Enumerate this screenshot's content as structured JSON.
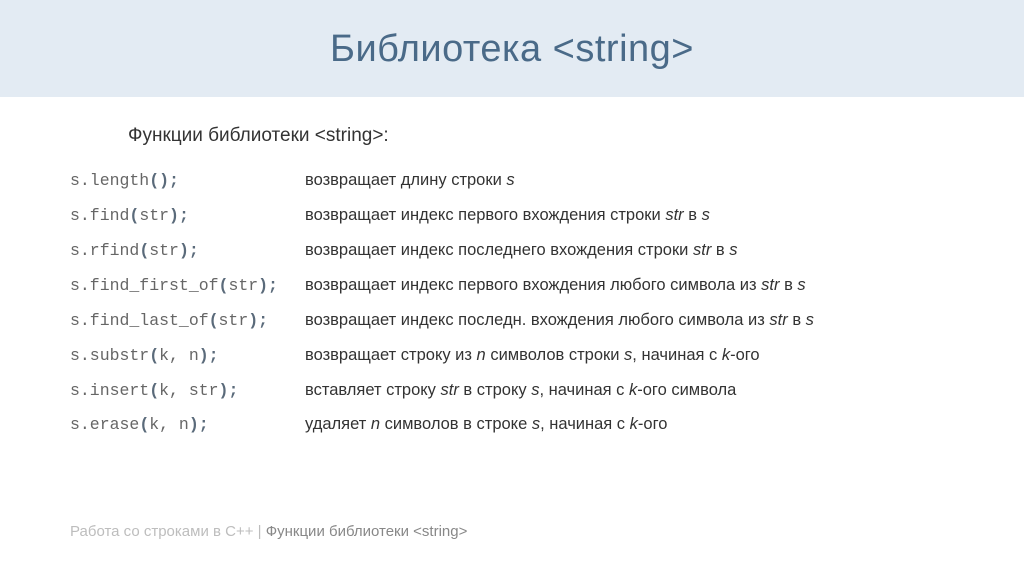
{
  "title": "Библиотека <string>",
  "subtitle": "Функции библиотеки <string>:",
  "rows": [
    {
      "code": "s.length<b>();</b>",
      "desc": "возвращает длину строки <i>s</i>"
    },
    {
      "code": "s.find<b>(</b>str<b>);</b>",
      "desc": "возвращает индекс первого вхождения строки <i>str</i> в <i>s</i>"
    },
    {
      "code": "s.rfind<b>(</b>str<b>);</b>",
      "desc": "возвращает индекс последнего вхождения строки <i>str</i> в <i>s</i>"
    },
    {
      "code": "s.find_first_of<b>(</b>str<b>);</b>",
      "desc": "возвращает индекс первого вхождения любого символа из <i>str</i> в <i>s</i>"
    },
    {
      "code": "s.find_last_of<b>(</b>str<b>);</b>",
      "desc": "возвращает индекс последн. вхождения любого символа из <i>str</i> в <i>s</i>"
    },
    {
      "code": "s.substr<b>(</b>k, n<b>);</b>",
      "desc": "возвращает строку из <i>n</i> символов строки <i>s</i>, начиная с <i>k</i>-ого"
    },
    {
      "code": "s.insert<b>(</b>k, str<b>);</b>",
      "desc": "вставляет строку <i>str</i> в строку <i>s</i>, начиная с <i>k</i>-ого символа"
    },
    {
      "code": "s.erase<b>(</b>k, n<b>);</b>",
      "desc": "удаляет <i>n</i> символов в строке <i>s</i>, начиная с <i>k</i>-ого"
    }
  ],
  "footer_light": "Работа со строками в С++ | ",
  "footer_dark": "Функции библиотеки <string>"
}
